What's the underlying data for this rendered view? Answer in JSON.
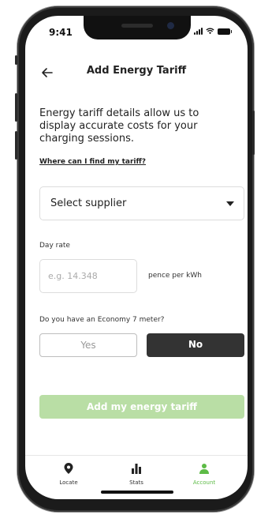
{
  "status_bar": {
    "time": "9:41"
  },
  "header": {
    "title": "Add Energy Tariff"
  },
  "intro": {
    "description": "Energy tariff details allow us to display accurate costs for your charging sessions.",
    "help_link": "Where can I find my tariff?"
  },
  "supplier": {
    "selected": "Select supplier"
  },
  "day_rate": {
    "label": "Day rate",
    "placeholder": "e.g. 14.348",
    "value": "",
    "unit": "pence per kWh"
  },
  "economy7": {
    "question": "Do you have an Economy 7 meter?",
    "yes_label": "Yes",
    "no_label": "No",
    "selected": "No"
  },
  "submit": {
    "label": "Add my energy tariff",
    "color": "#b9dea5"
  },
  "tabs": [
    {
      "label": "Locate",
      "icon": "location-pin-icon",
      "active": false
    },
    {
      "label": "Stats",
      "icon": "bar-chart-icon",
      "active": false
    },
    {
      "label": "Account",
      "icon": "person-icon",
      "active": true
    }
  ],
  "colors": {
    "accent": "#5dbb46",
    "dark": "#333333"
  }
}
